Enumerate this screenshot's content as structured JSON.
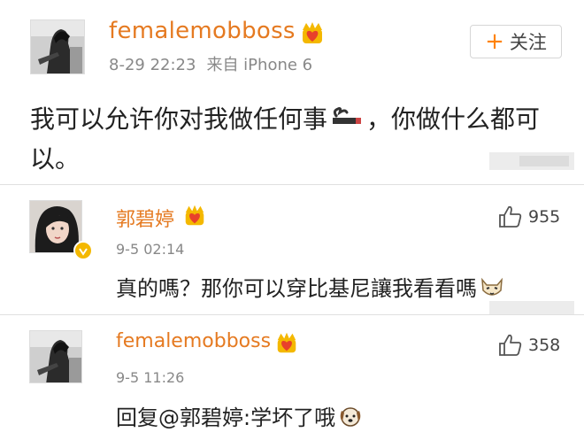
{
  "post": {
    "username": "femalemobboss",
    "badge_icon": "vip-crown-heart-icon",
    "timestamp": "8-29 22:23",
    "source": "来自 iPhone 6",
    "follow_label": "关注",
    "text_before_emoji": "我可以允许你对我做任何事",
    "emoji": "smoking-cigarette-emoji",
    "text_after_emoji": "，你做什么都可以。"
  },
  "comments": [
    {
      "username": "郭碧婷",
      "badge_icon": "vip-crown-heart-icon",
      "verified": true,
      "timestamp": "9-5 02:14",
      "text": "真的嗎？那你可以穿比基尼讓我看看嗎",
      "emoji": "cat-face-emoji",
      "likes": "955"
    },
    {
      "username": "femalemobboss",
      "badge_icon": "vip-crown-heart-icon",
      "verified": false,
      "timestamp": "9-5 11:26",
      "reply_prefix": "回复",
      "reply_mention": "@郭碧婷",
      "text": ":学坏了哦",
      "emoji": "dog-face-emoji",
      "likes": "358"
    }
  ],
  "colors": {
    "username": "#e57a21",
    "meta": "#888888",
    "follow_plus": "#ff8200",
    "verified": "#f4b800"
  }
}
